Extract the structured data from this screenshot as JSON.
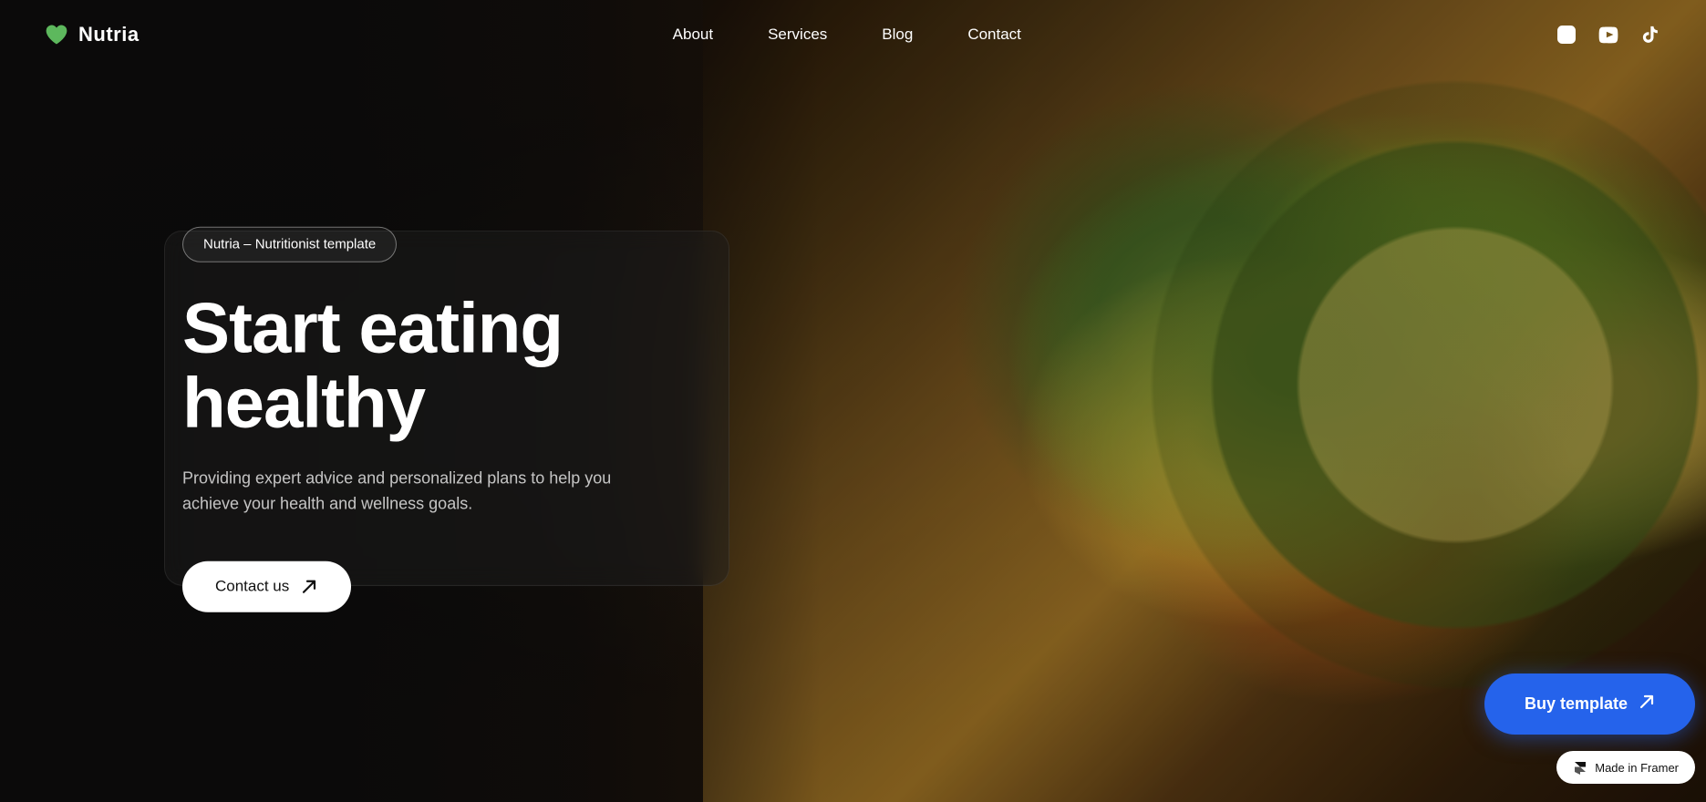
{
  "brand": {
    "name": "Nutria",
    "logo_color": "#5db85d"
  },
  "nav": {
    "links": [
      {
        "label": "About",
        "href": "#about"
      },
      {
        "label": "Services",
        "href": "#services"
      },
      {
        "label": "Blog",
        "href": "#blog"
      },
      {
        "label": "Contact",
        "href": "#contact"
      }
    ],
    "social": [
      {
        "name": "instagram",
        "label": "Instagram"
      },
      {
        "name": "youtube",
        "label": "YouTube"
      },
      {
        "name": "tiktok",
        "label": "TikTok"
      }
    ]
  },
  "hero": {
    "badge": "Nutria – Nutritionist template",
    "title": "Start eating healthy",
    "subtitle": "Providing expert advice and personalized plans to help you achieve your health and wellness goals.",
    "cta_label": "Contact us"
  },
  "buy_template": {
    "label": "Buy template"
  },
  "framer_badge": {
    "label": "Made in Framer"
  }
}
